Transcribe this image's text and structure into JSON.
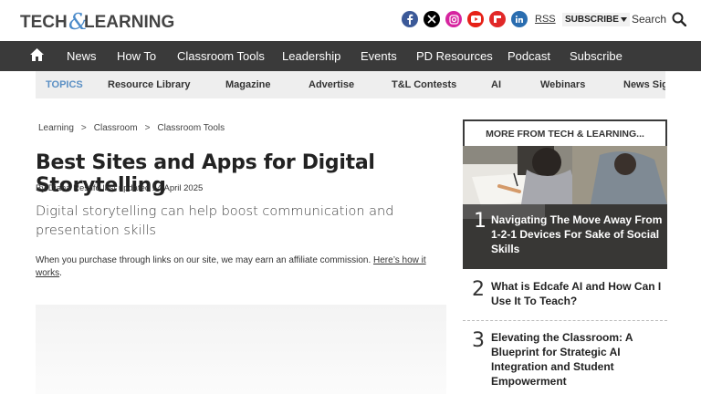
{
  "brand": {
    "logo_text_left": "TECH",
    "logo_amp": "&",
    "logo_text_right": "LEARNING",
    "colors": {
      "logo_dark": "#444444",
      "logo_amp": "#4a8ac9",
      "nav_bg": "#3a3a3a",
      "topics_accent": "#5a8fc4"
    }
  },
  "header": {
    "socials": [
      {
        "icon": "facebook-icon",
        "color": "#3b5998"
      },
      {
        "icon": "x-icon",
        "color": "#000000"
      },
      {
        "icon": "instagram-icon",
        "color": "#d6249f"
      },
      {
        "icon": "youtube-icon",
        "color": "#e62117"
      },
      {
        "icon": "flipboard-icon",
        "color": "#e12828"
      },
      {
        "icon": "linkedin-icon",
        "color": "#2a6db0"
      }
    ],
    "rss_label": "RSS",
    "subscribe_label": "SUBSCRIBE",
    "search_label": "Search"
  },
  "nav": {
    "items": [
      "News",
      "How To",
      "Classroom Tools",
      "Leadership",
      "Events",
      "PD Resources",
      "Podcast",
      "Subscribe"
    ]
  },
  "topics": {
    "label": "TOPICS",
    "items": [
      "Resource Library",
      "Magazine",
      "Advertise",
      "T&L Contests",
      "AI",
      "Webinars",
      "News Sig"
    ]
  },
  "article": {
    "breadcrumb": [
      "Learning",
      "Classroom",
      "Classroom Tools"
    ],
    "breadcrumb_sep": ">",
    "title": "Best Sites and Apps for Digital Storytelling",
    "byline": "By Diana Restifo last updated 14 April 2025",
    "subtitle": "Digital storytelling can help boost communication and presentation skills",
    "affiliate_text": "When you purchase through links on our site, we may earn an affiliate commission.",
    "affiliate_link": "Here’s how it works",
    "affiliate_end": "."
  },
  "sidebar": {
    "heading": "MORE FROM TECH & LEARNING...",
    "items": [
      {
        "num": "1",
        "title": "Navigating The Move Away From 1-2-1 Devices For Sake of Social Skills"
      },
      {
        "num": "2",
        "title": "What is Edcafe AI and How Can I Use It To Teach?"
      },
      {
        "num": "3",
        "title": "Elevating the Classroom: A Blueprint for Strategic AI Integration and Student Empowerment"
      }
    ]
  }
}
